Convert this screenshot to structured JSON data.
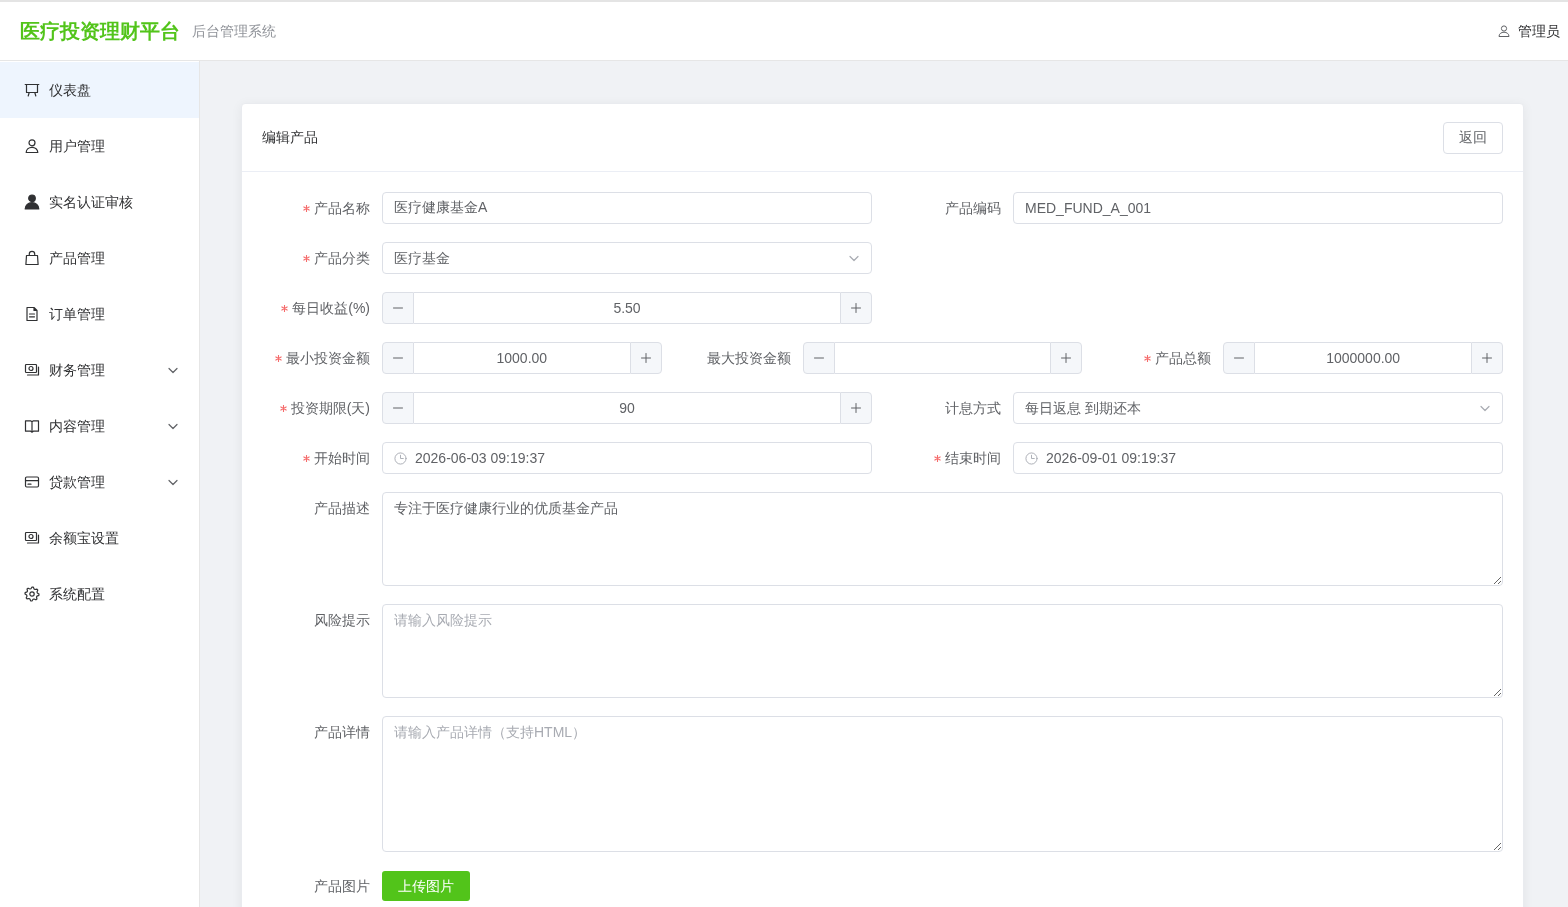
{
  "header": {
    "logo": "医疗投资理财平台",
    "subtitle": "后台管理系统",
    "user": "管理员"
  },
  "sidebar": {
    "items": [
      {
        "label": "仪表盘",
        "selected": true,
        "submenu": false
      },
      {
        "label": "用户管理",
        "selected": false,
        "submenu": false
      },
      {
        "label": "实名认证审核",
        "selected": false,
        "submenu": false
      },
      {
        "label": "产品管理",
        "selected": false,
        "submenu": false
      },
      {
        "label": "订单管理",
        "selected": false,
        "submenu": false
      },
      {
        "label": "财务管理",
        "selected": false,
        "submenu": true
      },
      {
        "label": "内容管理",
        "selected": false,
        "submenu": true
      },
      {
        "label": "贷款管理",
        "selected": false,
        "submenu": true
      },
      {
        "label": "余额宝设置",
        "selected": false,
        "submenu": false
      },
      {
        "label": "系统配置",
        "selected": false,
        "submenu": false
      }
    ]
  },
  "form": {
    "title": "编辑产品",
    "back_button": "返回",
    "rows": [
      {
        "fields": [
          {
            "kind": "text",
            "label": "产品名称",
            "required": true,
            "value": "医疗健康基金A"
          },
          {
            "kind": "text",
            "label": "产品编码",
            "required": false,
            "value": "MED_FUND_A_001"
          }
        ]
      },
      {
        "fields": [
          {
            "kind": "select",
            "label": "产品分类",
            "required": true,
            "value": "医疗基金"
          }
        ]
      },
      {
        "fields": [
          {
            "kind": "number",
            "label": "每日收益(%)",
            "required": true,
            "value": "5.50"
          }
        ]
      },
      {
        "fields": [
          {
            "kind": "number",
            "label": "最小投资金额",
            "required": true,
            "value": "1000.00"
          },
          {
            "kind": "number",
            "label": "最大投资金额",
            "required": false
          },
          {
            "kind": "number",
            "label": "产品总额",
            "required": true,
            "value": "1000000.00"
          }
        ]
      },
      {
        "fields": [
          {
            "kind": "number",
            "label": "投资期限(天)",
            "required": true,
            "value": "90"
          },
          {
            "kind": "select",
            "label": "计息方式",
            "required": false,
            "value": "每日返息 到期还本"
          }
        ]
      },
      {
        "fields": [
          {
            "kind": "date",
            "label": "开始时间",
            "required": true,
            "value": "2026-06-03 09:19:37"
          },
          {
            "kind": "date",
            "label": "结束时间",
            "required": true,
            "value": "2026-09-01 09:19:37"
          }
        ]
      },
      {
        "fields": [
          {
            "kind": "textarea",
            "label": "产品描述",
            "required": false,
            "value": "专注于医疗健康行业的优质基金产品"
          }
        ]
      },
      {
        "fields": [
          {
            "kind": "textarea",
            "label": "风险提示",
            "required": false,
            "placeholder": "请输入风险提示"
          }
        ]
      },
      {
        "fields": [
          {
            "kind": "longtext",
            "label": "产品详情",
            "required": false,
            "placeholder": "请输入产品详情（支持HTML）"
          }
        ]
      },
      {
        "fields": [
          {
            "kind": "upload",
            "label": "产品图片",
            "required": false,
            "button": "上传图片"
          }
        ]
      }
    ]
  }
}
